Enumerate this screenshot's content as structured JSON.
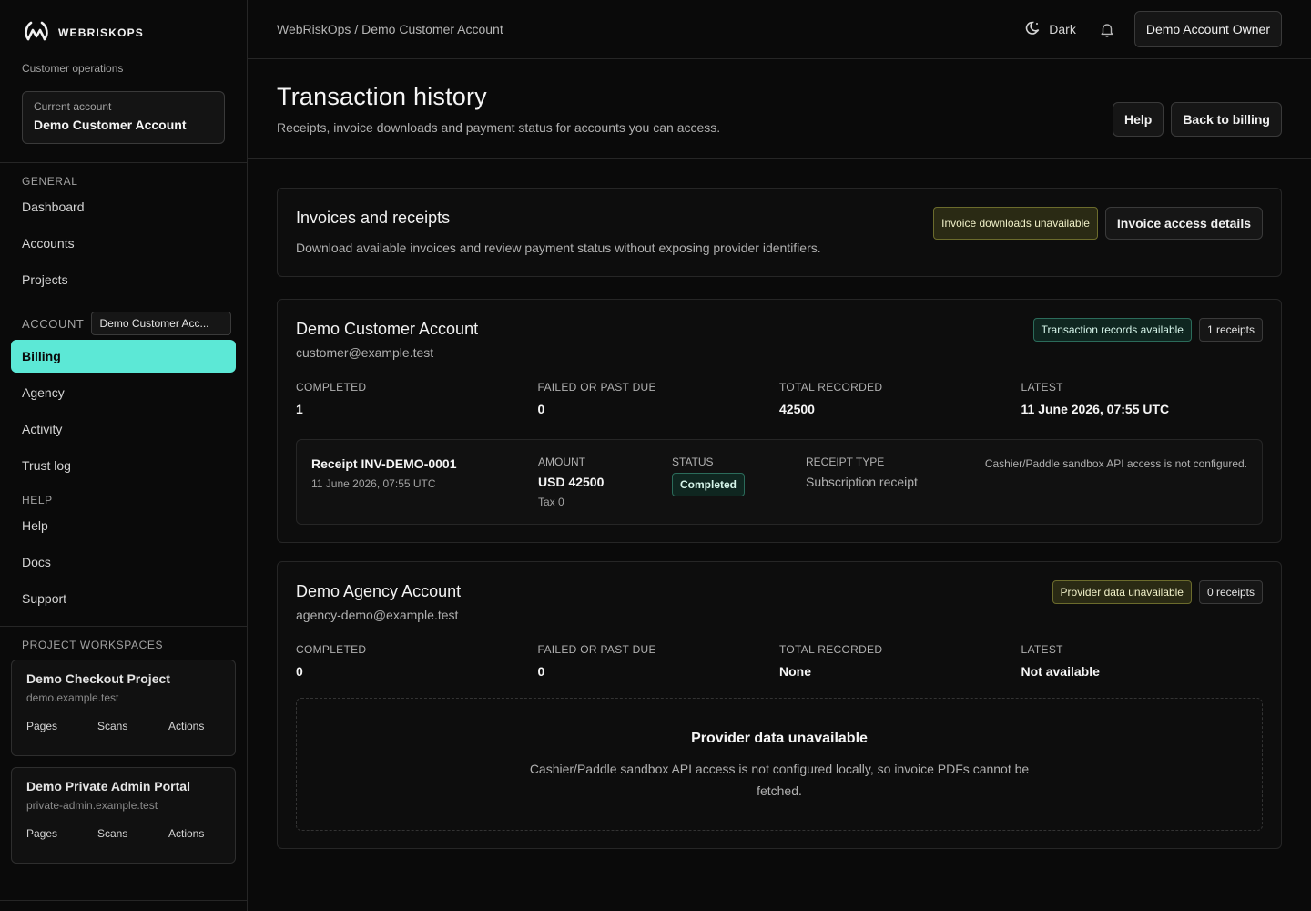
{
  "brand": {
    "name": "WEBRISKOPS",
    "subtitle": "Customer operations"
  },
  "current_account": {
    "label": "Current account",
    "value": "Demo Customer Account"
  },
  "sidebar": {
    "general_title": "GENERAL",
    "general_items": [
      "Dashboard",
      "Accounts",
      "Projects"
    ],
    "account_title": "ACCOUNT",
    "account_chip": "Demo Customer Acc...",
    "account_items": [
      "Billing",
      "Agency",
      "Activity",
      "Trust log"
    ],
    "help_title": "HELP",
    "help_items": [
      "Help",
      "Docs",
      "Support"
    ],
    "workspaces_title": "PROJECT WORKSPACES",
    "workspaces": [
      {
        "name": "Demo Checkout Project",
        "domain": "demo.example.test",
        "links": [
          "Pages",
          "Scans",
          "Actions"
        ]
      },
      {
        "name": "Demo Private Admin Portal",
        "domain": "private-admin.example.test",
        "links": [
          "Pages",
          "Scans",
          "Actions"
        ]
      }
    ]
  },
  "topbar": {
    "breadcrumb": "WebRiskOps / Demo Customer Account",
    "theme_label": "Dark",
    "user_button": "Demo Account Owner"
  },
  "page": {
    "title": "Transaction history",
    "subtitle": "Receipts, invoice downloads and payment status for accounts you can access.",
    "help_button": "Help",
    "back_button": "Back to billing"
  },
  "invoices": {
    "title": "Invoices and receipts",
    "subtitle": "Download available invoices and review payment status without exposing provider identifiers.",
    "badge": "Invoice downloads unavailable",
    "details_button": "Invoice access details"
  },
  "accounts": [
    {
      "name": "Demo Customer Account",
      "email": "customer@example.test",
      "status_badge": "Transaction records available",
      "count_badge": "1 receipts",
      "stats": [
        {
          "label": "COMPLETED",
          "value": "1"
        },
        {
          "label": "FAILED OR PAST DUE",
          "value": "0"
        },
        {
          "label": "TOTAL RECORDED",
          "value": "42500"
        },
        {
          "label": "LATEST",
          "value": "11 June 2026, 07:55 UTC"
        }
      ],
      "receipt": {
        "title": "Receipt INV-DEMO-0001",
        "date": "11 June 2026, 07:55 UTC",
        "amount_label": "AMOUNT",
        "amount": "USD 42500",
        "tax": "Tax 0",
        "status_label": "STATUS",
        "status": "Completed",
        "type_label": "RECEIPT TYPE",
        "type": "Subscription receipt",
        "note": "Cashier/Paddle sandbox API access is not configured."
      }
    },
    {
      "name": "Demo Agency Account",
      "email": "agency-demo@example.test",
      "status_badge": "Provider data unavailable",
      "count_badge": "0 receipts",
      "stats": [
        {
          "label": "COMPLETED",
          "value": "0"
        },
        {
          "label": "FAILED OR PAST DUE",
          "value": "0"
        },
        {
          "label": "TOTAL RECORDED",
          "value": "None"
        },
        {
          "label": "LATEST",
          "value": "Not available"
        }
      ],
      "empty": {
        "title": "Provider data unavailable",
        "line1": "Cashier/Paddle sandbox API access is not configured locally, so invoice PDFs cannot be",
        "line2": "fetched."
      }
    }
  ]
}
